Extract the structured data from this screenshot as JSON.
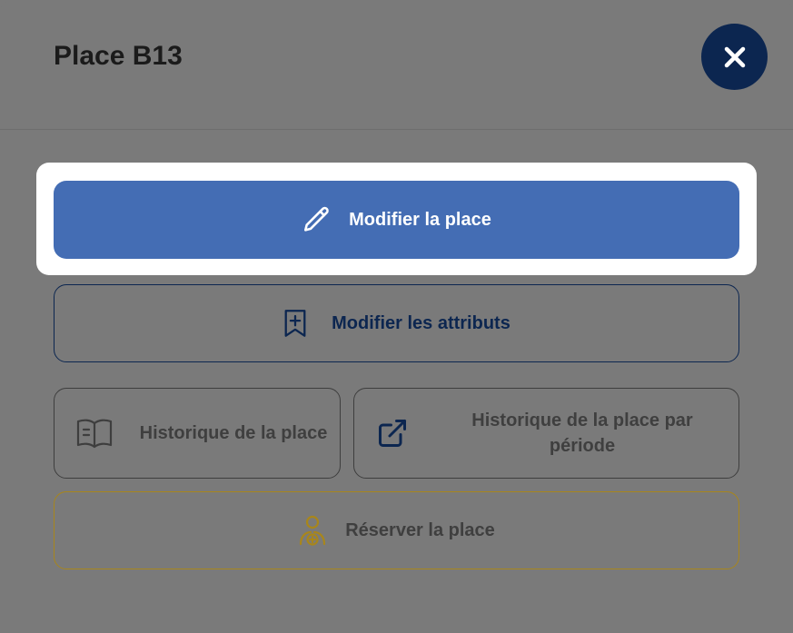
{
  "dialog": {
    "title": "Place B13"
  },
  "actions": {
    "edit_place": "Modifier la place",
    "edit_attributes": "Modifier les attributs",
    "history": "Historique de la place",
    "history_period": "Historique de la place par période",
    "reserve": "Réserver la place"
  },
  "icons": {
    "close": "close-icon",
    "edit": "pencil-icon",
    "attributes": "bookmark-plus-icon",
    "history": "book-open-icon",
    "history_period": "external-link-icon",
    "reserve": "user-plus-icon"
  },
  "colors": {
    "overlay": "#7a7a7a",
    "primary": "#446db4",
    "navy": "#0c2650",
    "gold": "#a8861b"
  }
}
